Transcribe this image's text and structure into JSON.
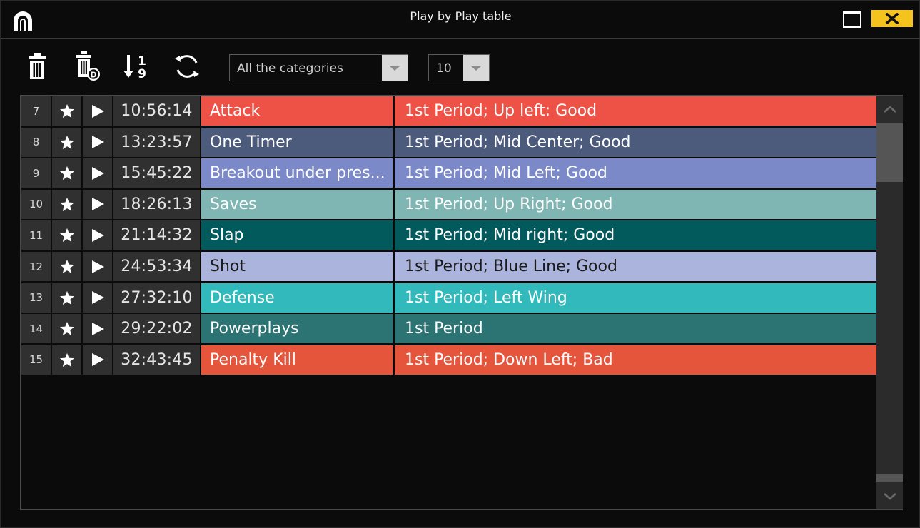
{
  "window": {
    "title": "Play by Play table"
  },
  "icons": {
    "logo": "arch-logo-icon",
    "maximize": "maximize-icon",
    "close": "close-icon",
    "delete": "trash-icon",
    "delete_d": "trash-d-icon",
    "sort": "sort-numeric-icon",
    "refresh": "refresh-icon",
    "star": "star-icon",
    "play": "play-icon"
  },
  "colors": {
    "close_button": "#f5c31d",
    "cell_bg": "#303030"
  },
  "toolbar": {
    "delete_d_badge": "D",
    "sort_top": "1",
    "sort_bottom": "9",
    "category_filter": {
      "value": "All the categories"
    },
    "page_size": {
      "value": "10"
    }
  },
  "rows": [
    {
      "num": "7",
      "time": "10:56:14",
      "name": "Attack",
      "desc": "1st Period; Up left: Good",
      "color": "#ee5146",
      "text": "#ffffff"
    },
    {
      "num": "8",
      "time": "13:23:57",
      "name": "One Timer",
      "desc": "1st Period; Mid Center; Good",
      "color": "#4c5a7c",
      "text": "#ffffff"
    },
    {
      "num": "9",
      "time": "15:45:22",
      "name": "Breakout under pres...",
      "desc": "1st Period; Mid Left; Good",
      "color": "#7b89c8",
      "text": "#ffffff"
    },
    {
      "num": "10",
      "time": "18:26:13",
      "name": "Saves",
      "desc": "1st Period; Up Right; Good",
      "color": "#7fb6b3",
      "text": "#ffffff"
    },
    {
      "num": "11",
      "time": "21:14:32",
      "name": "Slap",
      "desc": "1st Period; Mid right; Good",
      "color": "#035a5c",
      "text": "#ffffff"
    },
    {
      "num": "12",
      "time": "24:53:34",
      "name": "Shot",
      "desc": "1st Period; Blue Line; Good",
      "color": "#aab4dc",
      "text": "#1a1a1a"
    },
    {
      "num": "13",
      "time": "27:32:10",
      "name": "Defense",
      "desc": "1st Period; Left Wing",
      "color": "#31b9bb",
      "text": "#ffffff"
    },
    {
      "num": "14",
      "time": "29:22:02",
      "name": "Powerplays",
      "desc": "1st Period",
      "color": "#2c7474",
      "text": "#ffffff"
    },
    {
      "num": "15",
      "time": "32:43:45",
      "name": "Penalty Kill",
      "desc": "1st Period; Down Left; Bad",
      "color": "#e4553c",
      "text": "#ffffff"
    }
  ]
}
